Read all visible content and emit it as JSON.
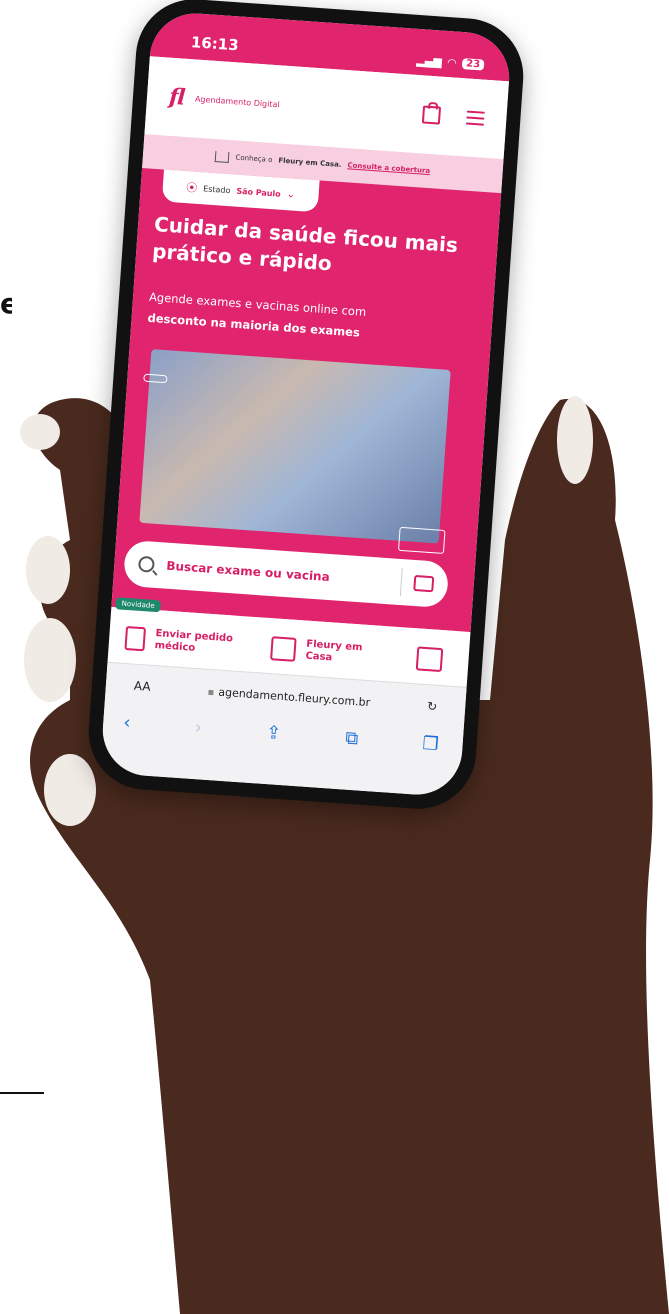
{
  "phone": {
    "status_time": "16:13",
    "battery": "23",
    "header": {
      "logo": "fl",
      "subtitle": "Agendamento Digital"
    },
    "banner": {
      "prefix": "Conheça o",
      "strong": "Fleury em Casa.",
      "link": "Consulte a cobertura"
    },
    "state_selector": {
      "prefix": "Estado",
      "value": "São Paulo"
    },
    "hero": {
      "title": "Cuidar da saúde ficou mais prático e rápido",
      "desc_prefix": "Agende exames e vacinas online com",
      "desc_bold": "desconto na maioria dos exames"
    },
    "search": {
      "placeholder": "Buscar exame ou vacina"
    },
    "cards": [
      {
        "badge": "Novidade",
        "label": "Enviar pedido médico"
      },
      {
        "label": "Fleury em Casa"
      },
      {
        "label": ""
      }
    ],
    "browser": {
      "text_size": "AA",
      "url": "agendamento.fleury.com.br"
    }
  },
  "icons": [
    "bag-icon",
    "menu-icon",
    "house-icon",
    "pin-icon",
    "chevron-down-icon",
    "search-icon",
    "camera-icon",
    "back-icon",
    "forward-icon",
    "share-icon",
    "bookmarks-icon",
    "tabs-icon",
    "reload-icon",
    "lock-icon"
  ],
  "colors": {
    "brand_pink": "#e0246d",
    "banner_pink": "#f7cfe0",
    "badge_green": "#1f8a6b"
  }
}
